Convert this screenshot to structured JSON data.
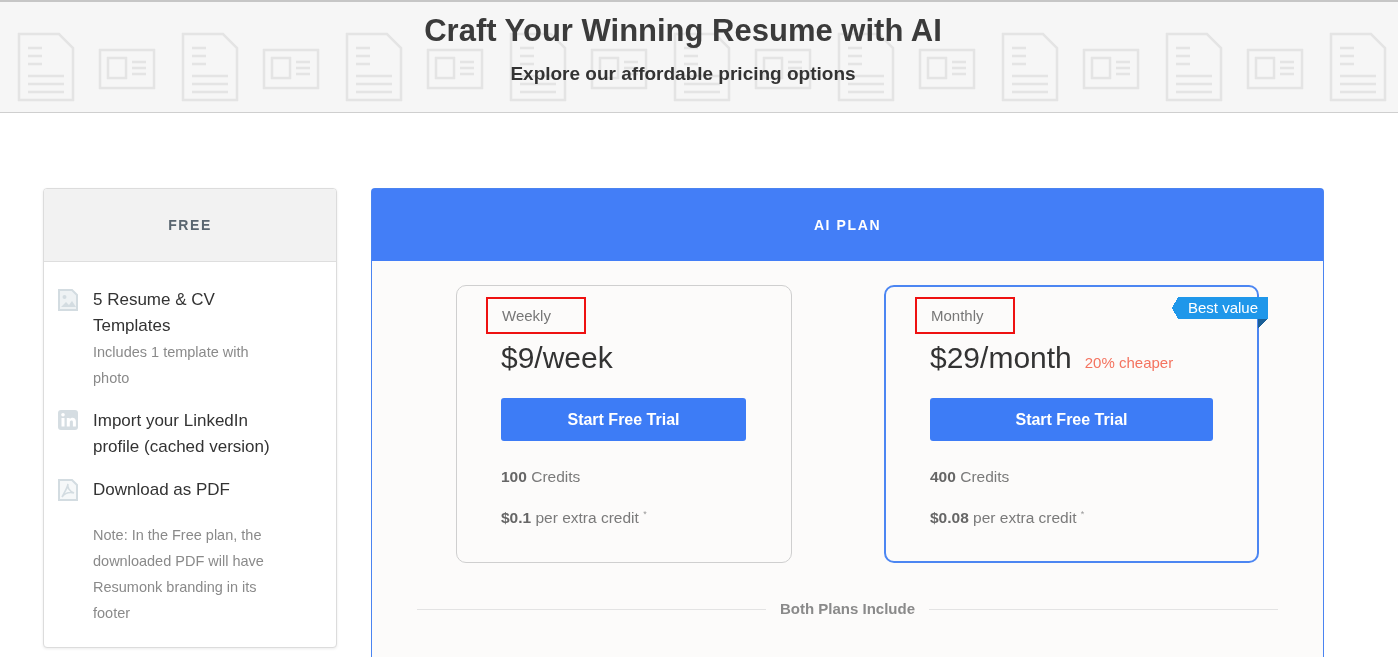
{
  "header": {
    "title": "Craft Your Winning Resume with AI",
    "subtitle": "Explore our affordable pricing options"
  },
  "free_plan": {
    "title": "FREE",
    "features": [
      {
        "kind": "image",
        "text": "5 Resume & CV Templates",
        "note": "Includes 1 template with photo"
      },
      {
        "kind": "linkedin",
        "text": "Import your LinkedIn profile (cached version)"
      },
      {
        "kind": "pdf",
        "text": "Download as PDF"
      }
    ],
    "note": "Note: In the Free plan, the downloaded PDF will have Resumonk branding in its footer"
  },
  "ai_plan": {
    "title": "AI PLAN",
    "plans": [
      {
        "label": "Weekly",
        "highlighted": true,
        "featured": false,
        "price": "$9/week",
        "button": "Start Free Trial",
        "credits": "**100** Credits",
        "extra": "**$0.1** per extra credit $^{*}$"
      },
      {
        "label": "Monthly",
        "highlighted": true,
        "featured": true,
        "badge": "Best value",
        "price": "$29/month",
        "discount": "20% cheaper",
        "button": "Start Free Trial",
        "credits": "**400** Credits",
        "extra": "**$0.08** per extra credit $^{*}$"
      }
    ],
    "includes_heading": "Both Plans Include"
  }
}
